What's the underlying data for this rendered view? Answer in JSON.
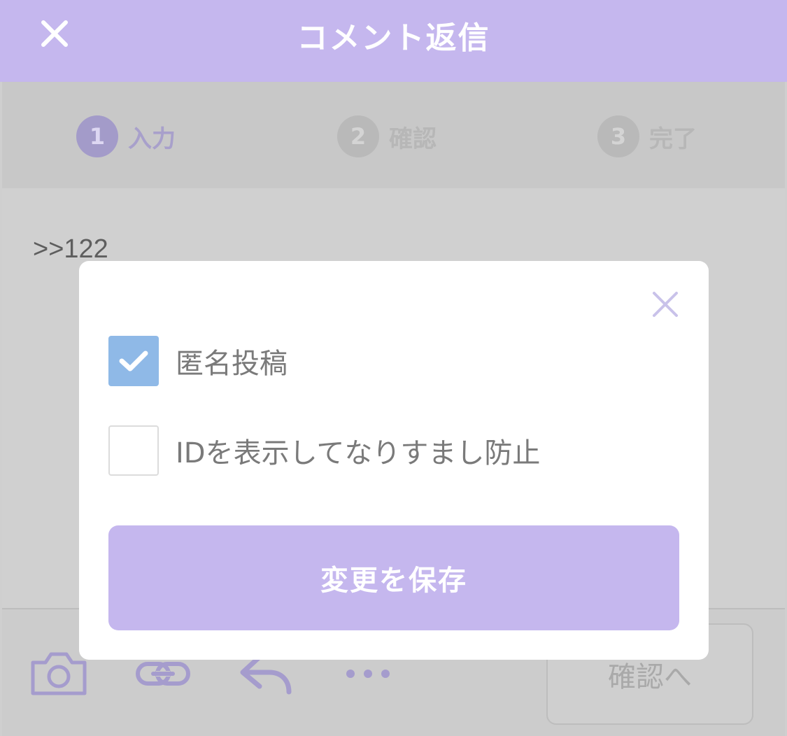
{
  "header": {
    "title": "コメント返信",
    "close_icon": "close-icon",
    "bg_color": "#c5b7ee"
  },
  "steps": [
    {
      "num": "1",
      "label": "入力",
      "active": true
    },
    {
      "num": "2",
      "label": "確認",
      "active": false
    },
    {
      "num": "3",
      "label": "完了",
      "active": false
    }
  ],
  "content": {
    "reply_text": ">>122"
  },
  "toolbar": {
    "icons": [
      "camera-icon",
      "link-icon",
      "reply-icon",
      "more-icon"
    ],
    "confirm_label": "確認へ"
  },
  "modal": {
    "close_icon": "close-icon",
    "options": [
      {
        "label": "匿名投稿",
        "checked": true
      },
      {
        "label": "IDを表示してなりすまし防止",
        "checked": false
      }
    ],
    "save_label": "変更を保存",
    "checkbox_color": "#8fb9e7",
    "button_color": "#c5b7ee"
  }
}
